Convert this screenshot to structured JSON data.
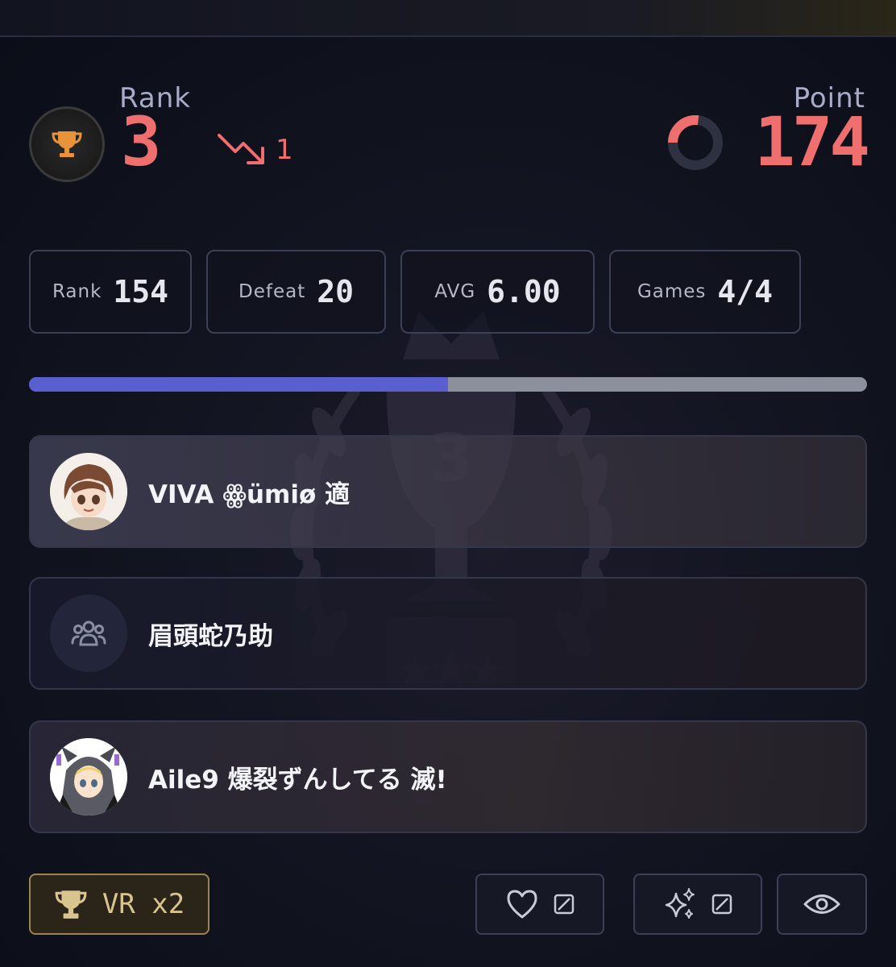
{
  "rank": {
    "label": "Rank",
    "value": "3",
    "change": "1",
    "change_direction": "down"
  },
  "point": {
    "label": "Point",
    "value": "174",
    "ring_progress": 0.27
  },
  "stats": [
    {
      "label": "Rank",
      "value": "154"
    },
    {
      "label": "Defeat",
      "value": "20"
    },
    {
      "label": "AVG",
      "value": "6.00"
    },
    {
      "label": "Games",
      "value": "4/4"
    }
  ],
  "progress": {
    "value": 0.5,
    "fill_color": "#5a5fd0"
  },
  "emblem": {
    "number": "3"
  },
  "players": [
    {
      "name": "VIVA ꙮümiø 適",
      "avatar": "anime-avatar-brown-hair"
    },
    {
      "name": "眉頭蛇乃助",
      "avatar": "group-icon"
    },
    {
      "name": "Aile9 爆裂ずんしてる 滅!",
      "avatar": "anime-avatar-blonde-hood"
    }
  ],
  "buttons": {
    "vr_label": "VR x2",
    "like_icon": "heart-icon",
    "sparkle_icon": "sparkle-icon",
    "view_icon": "eye-icon"
  },
  "colors": {
    "accent_red": "#ef6f6f",
    "progress_blue": "#5a5fd0",
    "gold": "#d8c48e"
  }
}
